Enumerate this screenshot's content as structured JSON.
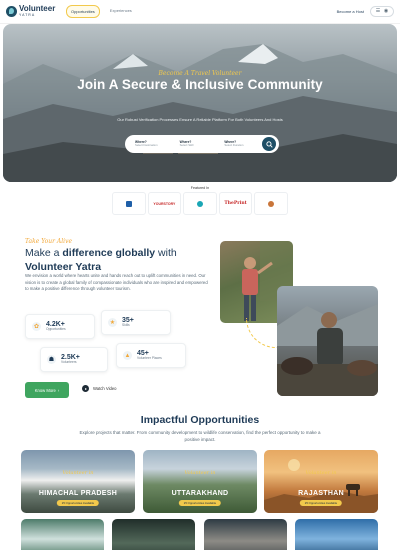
{
  "header": {
    "logo_title": "Volunteer",
    "logo_sub": "YATRA",
    "tabs": [
      {
        "label": "Opportunities",
        "active": true
      },
      {
        "label": "Experiences",
        "active": false
      }
    ],
    "host_link": "Become a Host",
    "menu_icon": "hamburger-icon",
    "user_icon": "user-icon"
  },
  "hero": {
    "script": "Become A Travel Volunteer",
    "title": "Join A Secure & Inclusive Community",
    "subtitle": "Our Robust Verification Processes Ensure A Reliable Platform For Both Volunteers And Hosts",
    "search": {
      "fields": [
        {
          "label": "Where?",
          "placeholder": "Select Destination"
        },
        {
          "label": "Where?",
          "placeholder": "Select Skill"
        },
        {
          "label": "Where?",
          "placeholder": "Select Duration"
        }
      ],
      "button_icon": "search-icon"
    }
  },
  "featured": {
    "label": "Featured In",
    "logos": [
      "",
      "YOURSTORY",
      "",
      "ThePrint",
      ""
    ]
  },
  "about": {
    "script": "Take Your Alive",
    "title_pre": "Make a ",
    "title_bold": "difference globally",
    "title_post": " with",
    "title_line2": "Volunteer Yatra",
    "text": "We envision a world where hearts unite and hands reach out to uplift communities in need. Our vision is to create a global family of compassionate individuals who are inspired and empowered to make a positive difference through volunteer tourism.",
    "stats": [
      {
        "value": "4.2K+",
        "label": "Opportunities",
        "icon": "opportunities-icon"
      },
      {
        "value": "35+",
        "label": "Skills",
        "icon": "star-icon"
      },
      {
        "value": "2.5K+",
        "label": "Volunteers",
        "icon": "volunteers-icon"
      },
      {
        "value": "45+",
        "label": "Volunteer Places",
        "icon": "mountain-icon"
      }
    ],
    "know_button": "Know More",
    "watch_label": "Watch Video"
  },
  "impactful": {
    "title": "Impactful Opportunities",
    "subtitle": "Explore projects that matter. From community development to wildlife conservation, find the perfect opportunity to make a positive impact.",
    "destinations": [
      {
        "script": "Volunteer in",
        "name": "HIMACHAL PRADESH",
        "count": "25 Opportunities Available"
      },
      {
        "script": "Volunteer in",
        "name": "UTTARAKHAND",
        "count": "25 Opportunities Available"
      },
      {
        "script": "Volunteer in",
        "name": "RAJASTHAN",
        "count": "25 Opportunities Available"
      }
    ]
  },
  "colors": {
    "brand": "#1f4f66",
    "accent": "#f2c94c",
    "button_green": "#3fa55f"
  }
}
